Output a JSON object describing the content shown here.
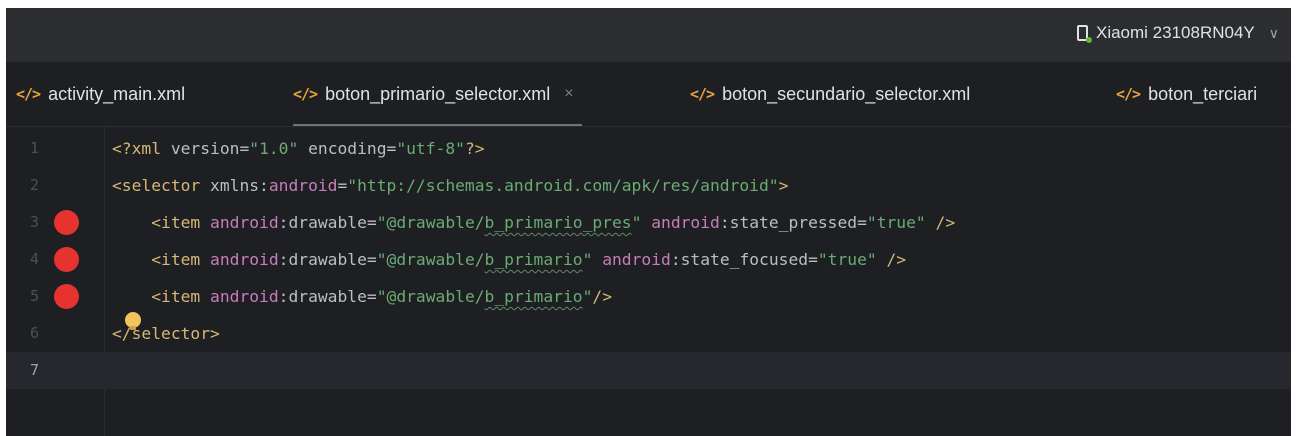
{
  "device": {
    "name": "Xiaomi 23108RN04Y",
    "status_color": "#5fb832",
    "icon": "phone-icon"
  },
  "tabs": [
    {
      "label": "activity_main.xml",
      "icon": "xml-file-icon",
      "active": false
    },
    {
      "label": "boton_primario_selector.xml",
      "icon": "xml-file-icon",
      "active": true,
      "close": "×"
    },
    {
      "label": "boton_secundario_selector.xml",
      "icon": "xml-file-icon",
      "active": false
    },
    {
      "label": "boton_terciari",
      "icon": "xml-file-icon",
      "active": false
    }
  ],
  "tab_icon_glyph": "</>",
  "editor": {
    "lines": [
      {
        "number": "1",
        "breakpoint": false
      },
      {
        "number": "2",
        "breakpoint": false
      },
      {
        "number": "3",
        "breakpoint": true
      },
      {
        "number": "4",
        "breakpoint": true
      },
      {
        "number": "5",
        "breakpoint": true
      },
      {
        "number": "6",
        "breakpoint": false
      },
      {
        "number": "7",
        "breakpoint": false,
        "current": true
      }
    ],
    "code": {
      "l1": {
        "open": "<?xml ",
        "a1": "version",
        "eq1": "=",
        "v1": "\"1.0\"",
        "sp": " ",
        "a2": "encoding",
        "eq2": "=",
        "v2": "\"utf-8\"",
        "close": "?>"
      },
      "l2": {
        "open": "<selector ",
        "a1": "xmlns:",
        "ns": "android",
        "eq": "=",
        "v": "\"http://schemas.android.com/apk/res/android\"",
        "close": ">"
      },
      "l3": {
        "indent": "    ",
        "open": "<item ",
        "ns1": "android",
        "a1": ":drawable",
        "eq1": "=",
        "q1": "\"@drawable/",
        "ref": "b_primario_pres",
        "q1e": "\"",
        "sp": " ",
        "ns2": "android",
        "a2": ":state_pressed",
        "eq2": "=",
        "v2": "\"true\"",
        "close": " />"
      },
      "l4": {
        "indent": "    ",
        "open": "<item ",
        "ns1": "android",
        "a1": ":drawable",
        "eq1": "=",
        "q1": "\"@drawable/",
        "ref": "b_primario",
        "q1e": "\"",
        "sp": " ",
        "ns2": "android",
        "a2": ":state_focused",
        "eq2": "=",
        "v2": "\"true\"",
        "close": " />"
      },
      "l5": {
        "indent": "    ",
        "open": "<item ",
        "ns1": "android",
        "a1": ":drawable",
        "eq1": "=",
        "q1": "\"@drawable/",
        "ref": "b_primario",
        "q1e": "\"",
        "close": "/>"
      },
      "l6": {
        "text": "</selector>"
      }
    },
    "intention_bulb": "lightbulb-icon",
    "breakpoint_color": "#e5332f"
  }
}
